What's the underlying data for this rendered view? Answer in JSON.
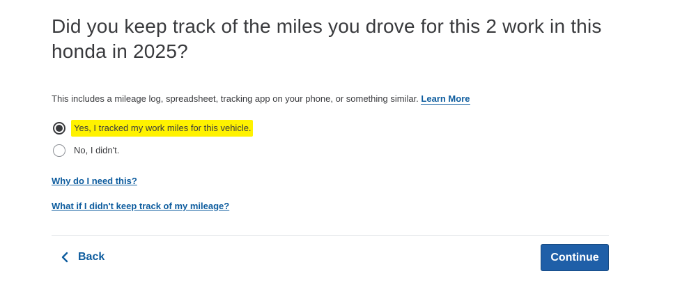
{
  "question": {
    "title": "Did you keep track of the miles you drove for this 2 work in this honda in 2025?"
  },
  "helper": {
    "text": "This includes a mileage log, spreadsheet, tracking app on your phone, or something similar.",
    "learn_more": "Learn More"
  },
  "options": [
    {
      "label": "Yes, I tracked my work miles for this vehicle.",
      "selected": true,
      "highlighted": true
    },
    {
      "label": "No, I didn't.",
      "selected": false,
      "highlighted": false
    }
  ],
  "help_links": {
    "why": "Why do I need this?",
    "what_if": "What if I didn't keep track of my mileage?"
  },
  "navigation": {
    "back_label": "Back",
    "back_icon": "chevron-left-icon",
    "continue_label": "Continue"
  },
  "colors": {
    "link": "#0d5c9e",
    "primary_button": "#1f5fa8",
    "highlight": "#fff200",
    "text": "#393a3d"
  }
}
